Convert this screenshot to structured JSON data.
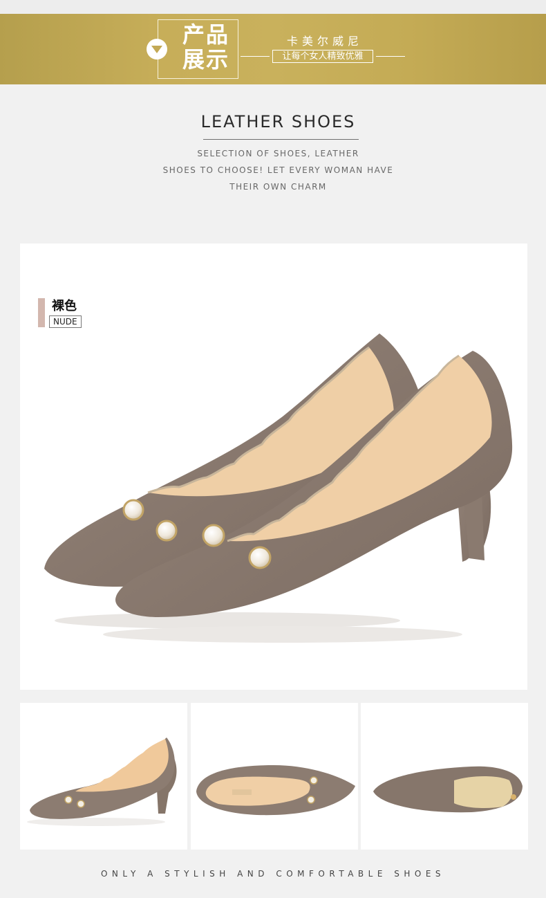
{
  "banner": {
    "title_line1": "产品",
    "title_line2": "展示",
    "brand": "卡美尔威尼",
    "slogan": "让每个女人精致优雅"
  },
  "section": {
    "heading": "LEATHER SHOES",
    "subtext_lines": [
      "SELECTION OF SHOES, LEATHER",
      "SHOES TO CHOOSE! LET EVERY WOMAN HAVE",
      "THEIR OWN CHARM"
    ]
  },
  "product": {
    "color_cn": "裸色",
    "color_en": "NUDE"
  },
  "footer": {
    "tagline": "ONLY A STYLISH AND COMFORTABLE SHOES"
  },
  "colors": {
    "banner_gold": "#c7ae59",
    "suede": "#8a7a70",
    "lining": "#f0cfa6",
    "accent_bar": "#d3b7ae"
  }
}
